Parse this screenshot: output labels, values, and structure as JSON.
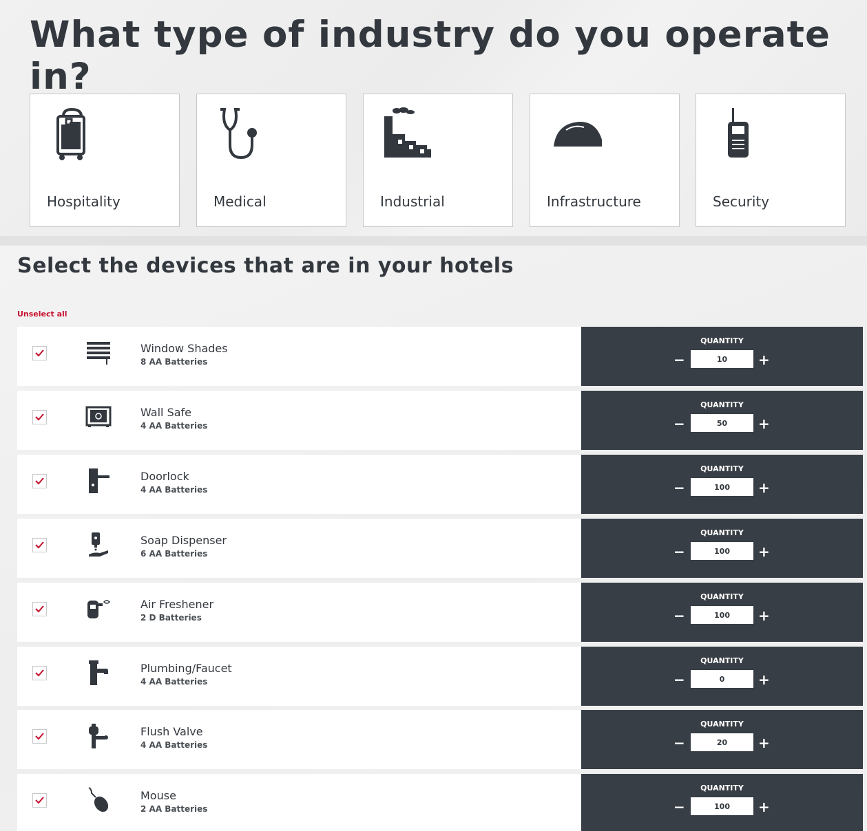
{
  "industry": {
    "title": "What type of industry do you operate in?",
    "options": [
      {
        "label": "Hospitality",
        "icon": "luggage-cart-icon"
      },
      {
        "label": "Medical",
        "icon": "stethoscope-icon"
      },
      {
        "label": "Industrial",
        "icon": "factory-icon"
      },
      {
        "label": "Infrastructure",
        "icon": "hard-hat-icon"
      },
      {
        "label": "Security",
        "icon": "radio-icon"
      }
    ]
  },
  "devices": {
    "title": "Select the devices that are in your hotels",
    "unselect_label": "Unselect all",
    "quantity_label": "QUANTITY",
    "minus_label": "−",
    "plus_label": "+",
    "accent_color": "#c8102e",
    "items": [
      {
        "name": "Window Shades",
        "batteries": "8 AA Batteries",
        "quantity": "10",
        "checked": true,
        "icon": "window-shades-icon"
      },
      {
        "name": "Wall Safe",
        "batteries": "4 AA Batteries",
        "quantity": "50",
        "checked": true,
        "icon": "wall-safe-icon"
      },
      {
        "name": "Doorlock",
        "batteries": "4 AA Batteries",
        "quantity": "100",
        "checked": true,
        "icon": "doorlock-icon"
      },
      {
        "name": "Soap Dispenser",
        "batteries": "6 AA Batteries",
        "quantity": "100",
        "checked": true,
        "icon": "soap-dispenser-icon"
      },
      {
        "name": "Air Freshener",
        "batteries": "2 D Batteries",
        "quantity": "100",
        "checked": true,
        "icon": "air-freshener-icon"
      },
      {
        "name": "Plumbing/Faucet",
        "batteries": "4 AA Batteries",
        "quantity": "0",
        "checked": true,
        "icon": "faucet-icon"
      },
      {
        "name": "Flush Valve",
        "batteries": "4 AA Batteries",
        "quantity": "20",
        "checked": true,
        "icon": "flush-valve-icon"
      },
      {
        "name": "Mouse",
        "batteries": "2 AA Batteries",
        "quantity": "100",
        "checked": true,
        "icon": "mouse-icon"
      }
    ]
  }
}
